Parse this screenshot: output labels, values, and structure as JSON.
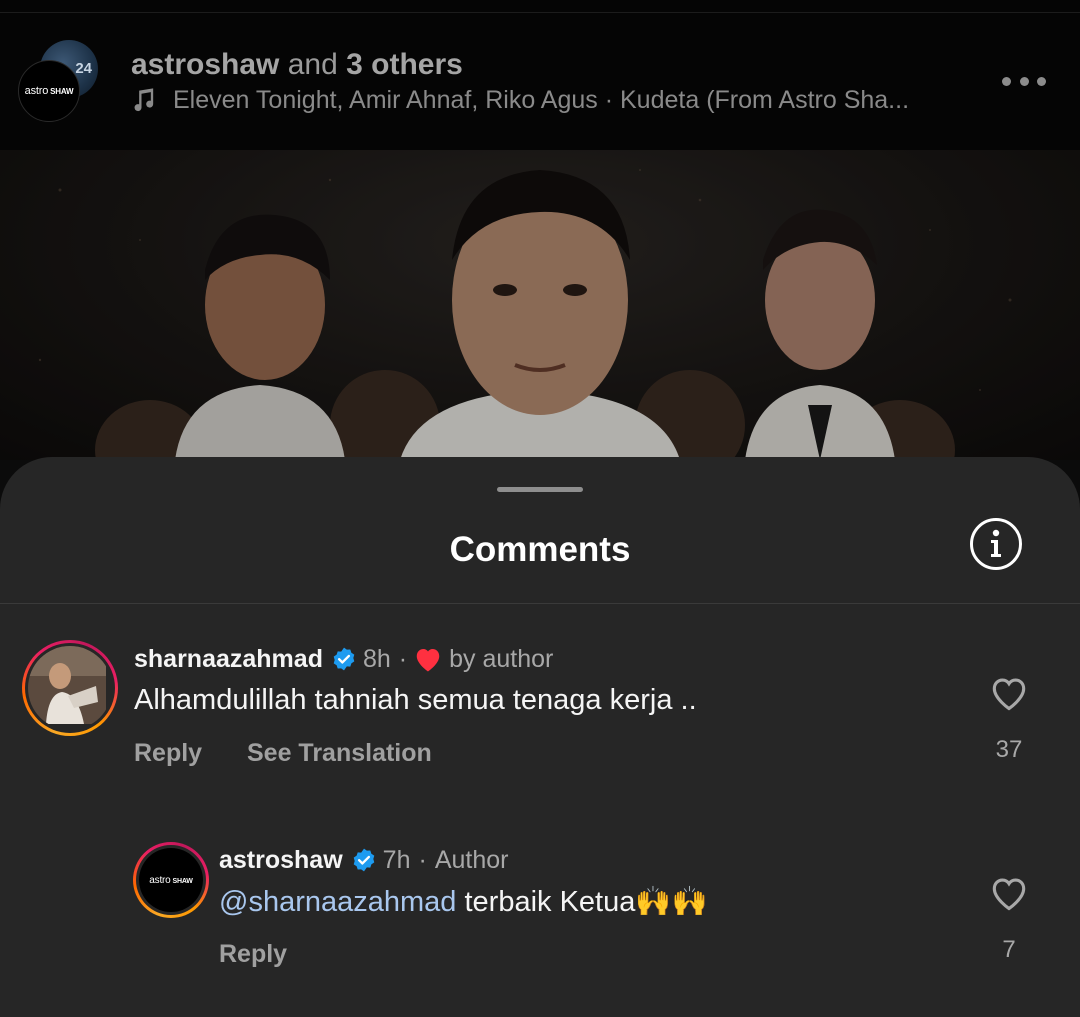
{
  "post_header": {
    "author": "astroshaw",
    "connector": "and",
    "others": "3 others",
    "music": "Eleven Tonight, Amir Ahnaf, Riko Agus · Kudeta (From Astro Sha...",
    "avatar_badge": "24",
    "logo_text": "astro",
    "logo_sub": "SHAW",
    "more_icon": "more-horizontal-icon",
    "music_icon": "music-note-icon"
  },
  "sheet": {
    "title": "Comments",
    "info_icon": "info-icon"
  },
  "comments": [
    {
      "username": "sharnaazahmad",
      "verified": true,
      "time": "8h",
      "separator": "·",
      "badge": "by author",
      "text": "Alhamdulillah tahniah semua tenaga kerja ..",
      "reply_label": "Reply",
      "translate_label": "See Translation",
      "likes": "37"
    },
    {
      "username": "astroshaw",
      "verified": true,
      "time": "7h",
      "separator": "·",
      "badge": "Author",
      "mention": "@sharnaazahmad",
      "text": " terbaik Ketua🙌🙌",
      "reply_label": "Reply",
      "likes": "7"
    }
  ],
  "colors": {
    "sheet_bg": "#262626",
    "verified": "#1d9bf0",
    "heart": "#ff3040",
    "mention": "#a9c7ee"
  }
}
